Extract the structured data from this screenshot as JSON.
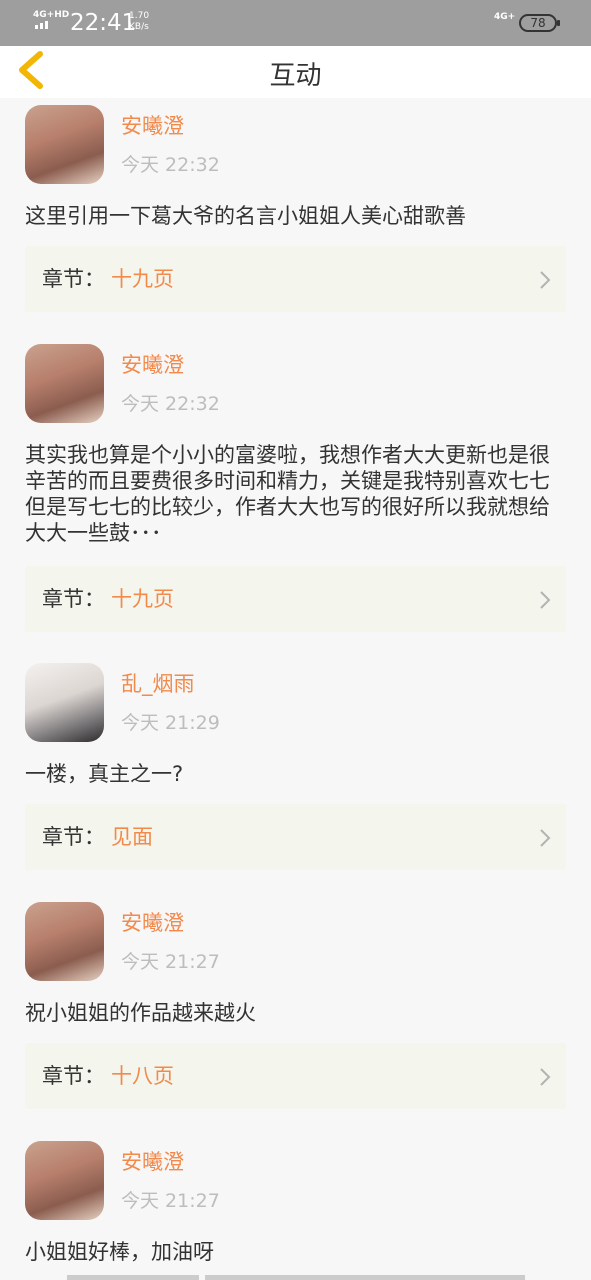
{
  "status_bar": {
    "network_left": "4G+HD",
    "time": "22:41",
    "speed_value": "1.70",
    "speed_unit": "KB/s",
    "network_right": "4G+",
    "battery": "78"
  },
  "header": {
    "title": "互动"
  },
  "comments": [
    {
      "username": "安曦澄",
      "time": "今天 22:32",
      "content": "这里引用一下葛大爷的名言小姐姐人美心甜歌善",
      "chapter_label": "章节：",
      "chapter_name": "十九页"
    },
    {
      "username": "安曦澄",
      "time": "今天 22:32",
      "content": "其实我也算是个小小的富婆啦，我想作者大大更新也是很辛苦的而且要费很多时间和精力，关键是我特别喜欢七七但是写七七的比较少，作者大大也写的很好所以我就想给大大一些鼓･･･",
      "chapter_label": "章节：",
      "chapter_name": "十九页"
    },
    {
      "username": "乱_烟雨",
      "time": "今天 21:29",
      "content": "一楼，真主之一?",
      "chapter_label": "章节：",
      "chapter_name": "见面"
    },
    {
      "username": "安曦澄",
      "time": "今天 21:27",
      "content": "祝小姐姐的作品越来越火",
      "chapter_label": "章节：",
      "chapter_name": "十八页"
    },
    {
      "username": "安曦澄",
      "time": "今天 21:27",
      "content": "小姐姐好棒，加油呀"
    }
  ],
  "colors": {
    "accent": "#f28a4c",
    "back_arrow": "#f2b705",
    "chapter_bg": "#f4f5ec"
  },
  "icons": {
    "back": "chevron-left-icon",
    "chapter_arrow": "chevron-right-icon"
  }
}
